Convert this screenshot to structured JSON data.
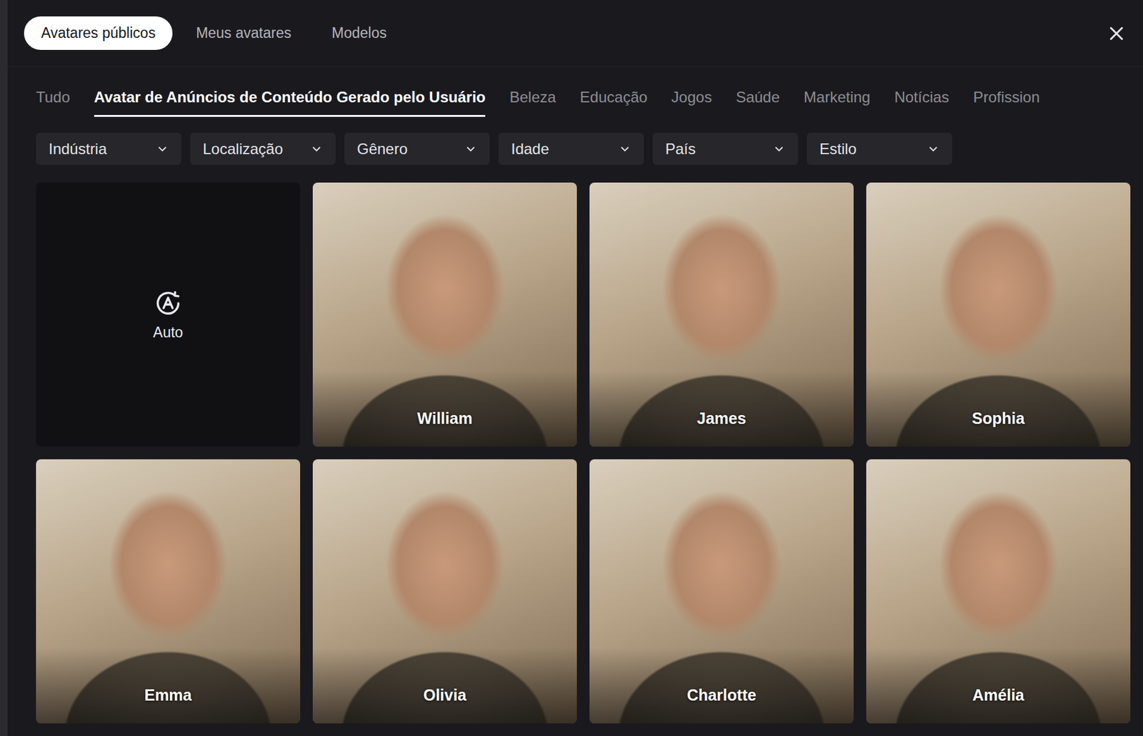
{
  "top_tabs": [
    {
      "label": "Avatares públicos",
      "selected": true
    },
    {
      "label": "Meus avatares",
      "selected": false
    },
    {
      "label": "Modelos",
      "selected": false
    }
  ],
  "categories": [
    {
      "label": "Tudo",
      "selected": false
    },
    {
      "label": "Avatar de Anúncios de Conteúdo Gerado pelo Usuário",
      "selected": true
    },
    {
      "label": "Beleza",
      "selected": false
    },
    {
      "label": "Educação",
      "selected": false
    },
    {
      "label": "Jogos",
      "selected": false
    },
    {
      "label": "Saúde",
      "selected": false
    },
    {
      "label": "Marketing",
      "selected": false
    },
    {
      "label": "Notícias",
      "selected": false
    },
    {
      "label": "Profission",
      "selected": false
    }
  ],
  "filters": [
    "Indústria",
    "Localização",
    "Gênero",
    "Idade",
    "País",
    "Estilo"
  ],
  "auto_card": {
    "label": "Auto"
  },
  "avatars": [
    {
      "name": "William"
    },
    {
      "name": "James"
    },
    {
      "name": "Sophia"
    },
    {
      "name": "Emma"
    },
    {
      "name": "Olivia"
    },
    {
      "name": "Charlotte"
    },
    {
      "name": "Amélia"
    }
  ]
}
